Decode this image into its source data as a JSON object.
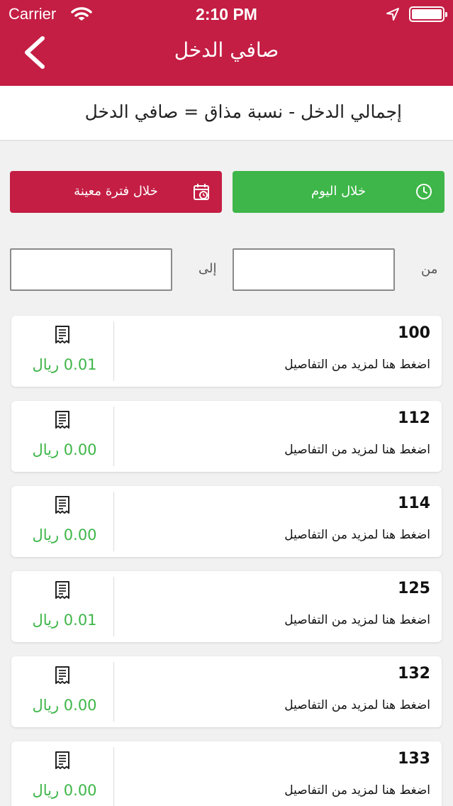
{
  "status_bar": {
    "carrier": "Carrier",
    "time": "2:10 PM"
  },
  "header": {
    "title": "صافي الدخل"
  },
  "formula": "إجمالي الدخل - نسبة مذاق = صافي الدخل",
  "filters": {
    "today_label": "خلال اليوم",
    "period_label": "خلال فترة معينة"
  },
  "date_range": {
    "from_label": "من",
    "to_label": "إلى",
    "from_value": "",
    "to_value": ""
  },
  "colors": {
    "brand": "#c41e44",
    "accent": "#3eb649"
  },
  "orders": [
    {
      "number": "100",
      "hint": "اضغط هنا لمزيد من التفاصيل",
      "amount": "0.01 ريال"
    },
    {
      "number": "112",
      "hint": "اضغط هنا لمزيد من التفاصيل",
      "amount": "0.00 ريال"
    },
    {
      "number": "114",
      "hint": "اضغط هنا لمزيد من التفاصيل",
      "amount": "0.00 ريال"
    },
    {
      "number": "125",
      "hint": "اضغط هنا لمزيد من التفاصيل",
      "amount": "0.01 ريال"
    },
    {
      "number": "132",
      "hint": "اضغط هنا لمزيد من التفاصيل",
      "amount": "0.00 ريال"
    },
    {
      "number": "133",
      "hint": "اضغط هنا لمزيد من التفاصيل",
      "amount": "0.00 ريال"
    }
  ]
}
